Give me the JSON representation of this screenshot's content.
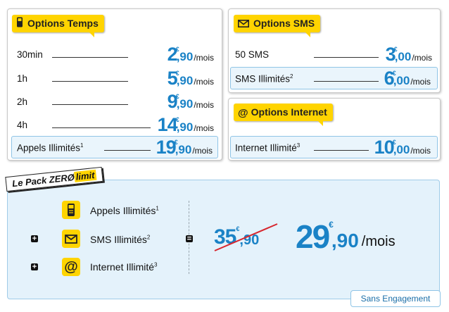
{
  "options_temps": {
    "title": "Options Temps",
    "rows": [
      {
        "label": "30min",
        "euros": "2",
        "cents": ",90",
        "unit": "/mois"
      },
      {
        "label": "1h",
        "euros": "5",
        "cents": ",90",
        "unit": "/mois"
      },
      {
        "label": "2h",
        "euros": "9",
        "cents": ",90",
        "unit": "/mois"
      },
      {
        "label": "4h",
        "euros": "14",
        "cents": ",90",
        "unit": "/mois"
      },
      {
        "label": "Appels Illimités",
        "sup": "1",
        "euros": "19",
        "cents": ",90",
        "unit": "/mois"
      }
    ]
  },
  "options_sms": {
    "title": "Options SMS",
    "rows": [
      {
        "label": "50 SMS",
        "euros": "3",
        "cents": ",00",
        "unit": "/mois"
      },
      {
        "label": "SMS Illimités",
        "sup": "2",
        "euros": "6",
        "cents": ",00",
        "unit": "/mois"
      }
    ]
  },
  "options_internet": {
    "title": "Options Internet",
    "rows": [
      {
        "label": "Internet Illimité",
        "sup": "3",
        "euros": "10",
        "cents": ",00",
        "unit": "/mois"
      }
    ]
  },
  "pack": {
    "badge_prefix": "Le Pack ",
    "badge_zero": "ZERØ",
    "badge_limit": "limit",
    "items": [
      {
        "label": "Appels Illimités",
        "sup": "1"
      },
      {
        "label": "SMS Illimités",
        "sup": "2"
      },
      {
        "label": "Internet Illimité",
        "sup": "3"
      }
    ],
    "old_price_euros": "35",
    "old_price_cents": ",90",
    "new_price_euros": "29",
    "new_price_cents": ",90",
    "new_price_unit": "/mois"
  },
  "currency_symbol": "€",
  "footer": {
    "sans_engagement": "Sans Engagement"
  },
  "colors": {
    "accent_yellow": "#ffd400",
    "price_blue": "#1a82c6",
    "strike_red": "#d7262d"
  }
}
